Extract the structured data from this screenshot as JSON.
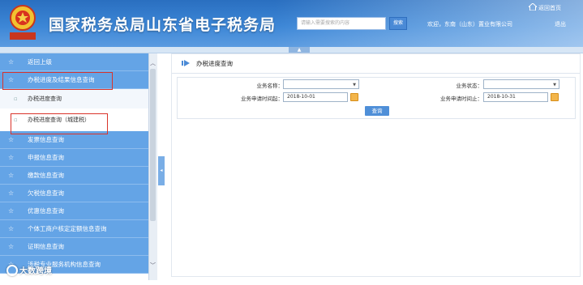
{
  "header": {
    "title": "国家税务总局山东省电子税务局",
    "search_placeholder": "请输入需要搜索的内容",
    "search_button": "搜索",
    "welcome": "欢迎，东南（山东）置业有限公司",
    "logout": "退出",
    "home_link": "返回首页",
    "emblem_caption": "中国税务"
  },
  "sidebar": {
    "items": [
      {
        "label": "返回上级"
      },
      {
        "label": "办税进度及结果信息查询"
      },
      {
        "label": "办税进度查询"
      },
      {
        "label": "办税进度查询（城建税）"
      },
      {
        "label": "发票信息查询"
      },
      {
        "label": "申报信息查询"
      },
      {
        "label": "缴款信息查询"
      },
      {
        "label": "欠税信息查询"
      },
      {
        "label": "优惠信息查询"
      },
      {
        "label": "个体工商户核定定额信息查询"
      },
      {
        "label": "证明信息查询"
      },
      {
        "label": "涉税专业服务机构信息查询"
      }
    ]
  },
  "main": {
    "title": "办税进度查询",
    "form": {
      "biz_name_label": "业务名称：",
      "biz_status_label": "业务状态：",
      "apply_start_label": "业务申请时间起：",
      "apply_start_value": "2018-10-01",
      "apply_end_label": "业务申请时间止：",
      "apply_end_value": "2018-10-31",
      "query_button": "查询"
    }
  },
  "watermark": {
    "text": "大数跨境"
  },
  "colors": {
    "header_blue": "#3c86d6",
    "nav_blue": "#64a4e6",
    "highlight_red": "#d9342b",
    "calendar_orange": "#f3b54a"
  }
}
